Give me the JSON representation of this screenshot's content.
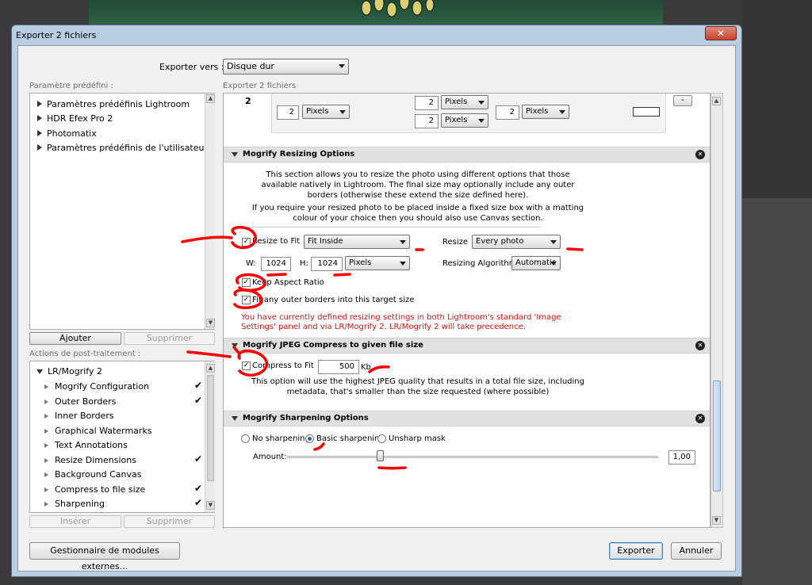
{
  "window": {
    "title": "Exporter 2 fichiers"
  },
  "export_to": {
    "label": "Exporter vers :",
    "value": "Disque dur"
  },
  "presets": {
    "caption": "Paramètre prédéfini :",
    "items": [
      {
        "label": "Paramètres prédéfinis Lightroom"
      },
      {
        "label": "HDR Efex Pro 2"
      },
      {
        "label": "Photomatix"
      },
      {
        "label": "Paramètres prédéfinis de l'utilisateur"
      }
    ],
    "add_button": "Ajouter",
    "remove_button": "Supprimer"
  },
  "post_actions": {
    "caption": "Actions de post-traitement :",
    "group": "LR/Mogrify 2",
    "items": [
      {
        "label": "Mogrify Configuration",
        "checked": true
      },
      {
        "label": "Outer Borders",
        "checked": true
      },
      {
        "label": "Inner Borders",
        "checked": false
      },
      {
        "label": "Graphical Watermarks",
        "checked": false
      },
      {
        "label": "Text Annotations",
        "checked": false
      },
      {
        "label": "Resize Dimensions",
        "checked": true
      },
      {
        "label": "Background Canvas",
        "checked": false
      },
      {
        "label": "Compress to file size",
        "checked": true
      },
      {
        "label": "Sharpening",
        "checked": true
      }
    ],
    "check_glyph": "✔",
    "insert_button": "Insérer",
    "remove_button": "Supprimer"
  },
  "right": {
    "caption": "Exporter 2 fichiers",
    "top_row": {
      "index": "2",
      "v1": "2",
      "u1": "Pixels",
      "v2": "2",
      "u2": "Pixels",
      "v3": "2",
      "u3": "Pixels",
      "v4": "2",
      "u4": "Pixels",
      "minus": "-"
    },
    "resizing": {
      "title": "Mogrify Resizing Options",
      "desc1": "This section allows you to resize the photo using different options that those available natively in Lightroom. The final size may optionally include any outer borders (otherwise these extend the size defined here).",
      "desc2": "If you require your resized photo to be placed inside a fixed size box with a matting colour of your choice then you should also use Canvas section.",
      "resize_to_fit": "Resize to Fit",
      "fit_mode": "Fit Inside",
      "resize_label": "Resize",
      "resize_value": "Every photo",
      "w_label": "W:",
      "w_value": "1024",
      "h_label": "H:",
      "h_value": "1024",
      "unit": "Pixels",
      "algo_label": "Resizing Algorithm:",
      "algo_value": "Automatic",
      "keep_aspect": "Keep Aspect Ratio",
      "fit_borders": "Fit any outer borders into this target size",
      "warning": "You have currently defined resizing settings in both Lightroom's standard 'Image Settings' panel and via LR/Mogrify 2.  LR/Mogrify 2 will take precedence."
    },
    "compress": {
      "title": "Mogrify JPEG Compress to given file size",
      "label": "Compress to Fit",
      "value": "500",
      "unit": "Kb",
      "desc": "This option will use the highest JPEG quality that results in a total file size, including metadata, that's smaller than the size requested (where possible)"
    },
    "sharpening": {
      "title": "Mogrify Sharpening Options",
      "options": [
        "No sharpening",
        "Basic sharpening",
        "Unsharp mask"
      ],
      "selected": 1,
      "amount_label": "Amount:",
      "amount": 1.0,
      "amount_text": "1,00"
    }
  },
  "footer": {
    "plugins_button": "Gestionnaire de modules externes...",
    "export_button": "Exporter",
    "cancel_button": "Annuler"
  },
  "colors": {
    "annotation": "#ff0000",
    "warning_text": "#e01010",
    "titlebar": "#b9cde3"
  }
}
